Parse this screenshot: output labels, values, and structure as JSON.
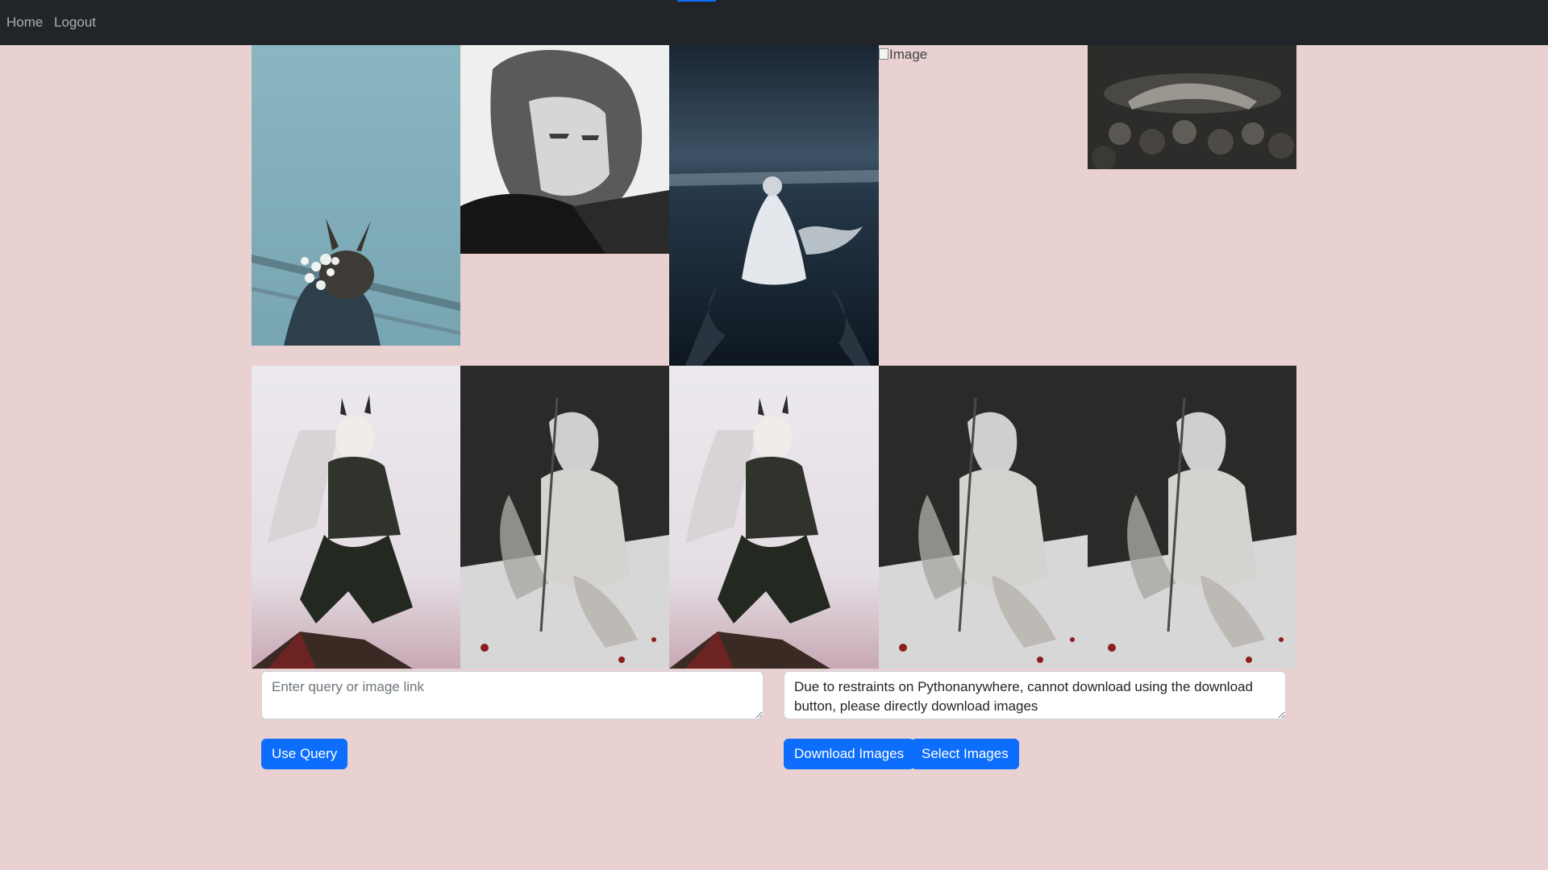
{
  "navbar": {
    "links": [
      {
        "label": "Home"
      },
      {
        "label": "Logout"
      }
    ]
  },
  "gallery": {
    "broken_image_alt": "Image",
    "images": [
      {
        "subject": "girl with white flowers leaning on railing, teal sky"
      },
      {
        "subject": "monochrome anime girl portrait"
      },
      {
        "subject": "girl in white dress standing in dark sea"
      },
      {
        "subject": "broken image"
      },
      {
        "subject": "figure lying among dark flowers"
      },
      {
        "subject": "white-haired horned girl with dark armor"
      },
      {
        "subject": "hooded girl kneeling with staff, dark background"
      },
      {
        "subject": "white-haired horned girl with dark armor"
      },
      {
        "subject": "hooded girl kneeling with staff, dark background"
      },
      {
        "subject": "hooded girl kneeling with staff, dark background"
      }
    ]
  },
  "query": {
    "placeholder": "Enter query or image link",
    "value": "",
    "button_label": "Use Query"
  },
  "download": {
    "notice": "Due to restraints on Pythonanywhere, cannot download using the download button, please directly download images",
    "download_label": "Download Images",
    "select_label": "Select Images"
  },
  "colors": {
    "background": "#e9d0d1",
    "navbar": "#212529",
    "button": "#0d6efd"
  }
}
